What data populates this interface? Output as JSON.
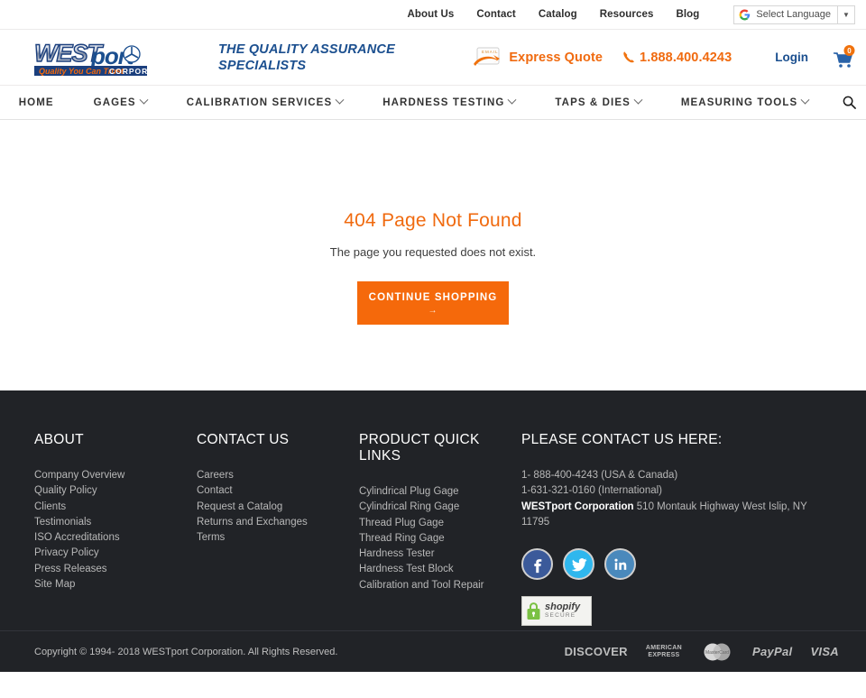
{
  "topbar": {
    "links": [
      {
        "label": "About Us"
      },
      {
        "label": "Contact"
      },
      {
        "label": "Catalog"
      },
      {
        "label": "Resources"
      },
      {
        "label": "Blog"
      }
    ],
    "translate": {
      "label": "Select Language",
      "icon": "google-g-icon",
      "arrow": "▼"
    }
  },
  "header": {
    "logo": {
      "west": "WEST",
      "port": "port",
      "corporation": "CORPORATION",
      "tagline_small": "Quality You Can Trust"
    },
    "tagline": "THE QUALITY ASSURANCE SPECIALISTS",
    "express_quote": {
      "label": "Express Quote",
      "icon": "email-envelope-icon",
      "badge": "EMAIL"
    },
    "phone": {
      "number": "1.888.400.4243",
      "icon": "phone-icon"
    },
    "login": {
      "label": "Login"
    },
    "cart": {
      "icon": "shopping-cart-icon",
      "count": "0"
    }
  },
  "nav": {
    "items": [
      {
        "label": "HOME",
        "has_caret": false
      },
      {
        "label": "GAGES",
        "has_caret": true
      },
      {
        "label": "CALIBRATION SERVICES",
        "has_caret": true
      },
      {
        "label": "HARDNESS TESTING",
        "has_caret": true
      },
      {
        "label": "TAPS & DIES",
        "has_caret": true
      },
      {
        "label": "MEASURING TOOLS",
        "has_caret": true
      }
    ],
    "search_icon": "search-icon"
  },
  "main": {
    "title": "404 Page Not Found",
    "subtitle": "The page you requested does not exist.",
    "cta_label": "CONTINUE SHOPPING",
    "cta_arrow": "→"
  },
  "footer": {
    "about": {
      "heading": "ABOUT",
      "links": [
        {
          "label": "Company Overview"
        },
        {
          "label": "Quality Policy"
        },
        {
          "label": "Clients"
        },
        {
          "label": "Testimonials"
        },
        {
          "label": "ISO Accreditations"
        },
        {
          "label": "Privacy Policy"
        },
        {
          "label": "Press Releases"
        },
        {
          "label": "Site Map"
        }
      ]
    },
    "contact": {
      "heading": "CONTACT US",
      "links": [
        {
          "label": "Careers"
        },
        {
          "label": "Contact"
        },
        {
          "label": "Request a Catalog"
        },
        {
          "label": "Returns and Exchanges"
        },
        {
          "label": "Terms"
        }
      ]
    },
    "products": {
      "heading": "PRODUCT QUICK LINKS",
      "links": [
        {
          "label": "Cylindrical Plug Gage"
        },
        {
          "label": "Cylindrical Ring Gage"
        },
        {
          "label": "Thread Plug Gage"
        },
        {
          "label": "Thread Ring Gage"
        },
        {
          "label": "Hardness Tester"
        },
        {
          "label": "Hardness Test Block"
        },
        {
          "label": "Calibration and Tool Repair"
        }
      ]
    },
    "contact_info": {
      "heading": "PLEASE CONTACT US HERE:",
      "phone_usa": "1- 888-400-4243 (USA & Canada)",
      "phone_intl": "1-631-321-0160 (International)",
      "company": "WESTport Corporation",
      "address": " 510 Montauk Highway West Islip, NY 11795"
    },
    "socials": [
      {
        "name": "facebook-icon",
        "glyph": "f",
        "color": "#3b5a9a"
      },
      {
        "name": "twitter-icon",
        "glyph": "🐦",
        "color": "#2fb7ee"
      },
      {
        "name": "linkedin-icon",
        "glyph": "in",
        "color": "#4a89bc"
      }
    ],
    "shopify": {
      "name": "shopify",
      "secure": "SECURE",
      "icon": "lock-icon"
    }
  },
  "bottombar": {
    "copyright": "Copyright © 1994- 2018 WESTport Corporation. All Rights Reserved.",
    "payments": [
      {
        "label": "DISCOVER",
        "name": "discover-icon"
      },
      {
        "label": "AMERICAN EXPRESS",
        "name": "amex-icon"
      },
      {
        "label": "MasterCard",
        "name": "mastercard-icon"
      },
      {
        "label": "PayPal",
        "name": "paypal-icon"
      },
      {
        "label": "VISA",
        "name": "visa-icon"
      }
    ]
  },
  "colors": {
    "accent_orange": "#f5690b",
    "brand_blue": "#1b4f8f",
    "footer_bg": "#212327"
  }
}
